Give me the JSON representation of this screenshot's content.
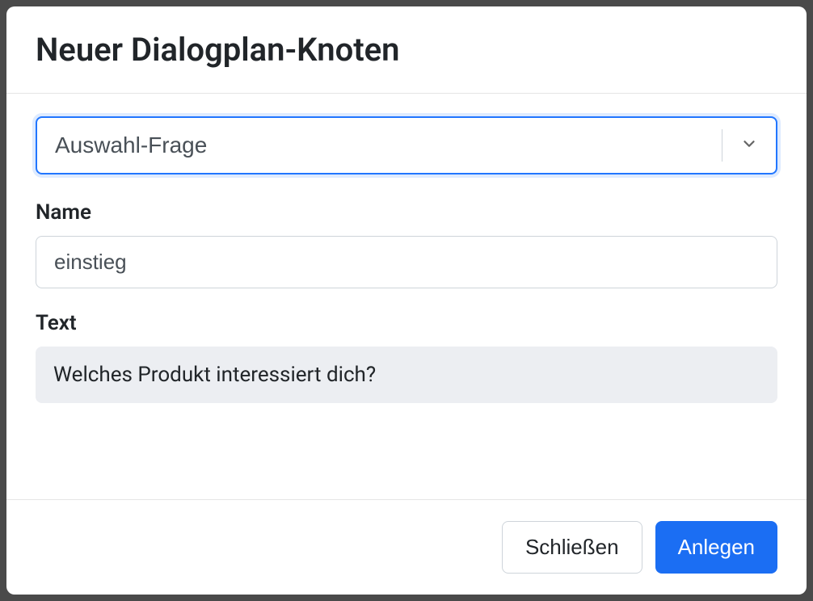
{
  "modal": {
    "title": "Neuer Dialogplan-Knoten",
    "type_select": {
      "value": "Auswahl-Frage"
    },
    "name_field": {
      "label": "Name",
      "value": "einstieg"
    },
    "text_field": {
      "label": "Text",
      "value": "Welches Produkt interessiert dich?"
    },
    "footer": {
      "close_label": "Schließen",
      "create_label": "Anlegen"
    }
  }
}
